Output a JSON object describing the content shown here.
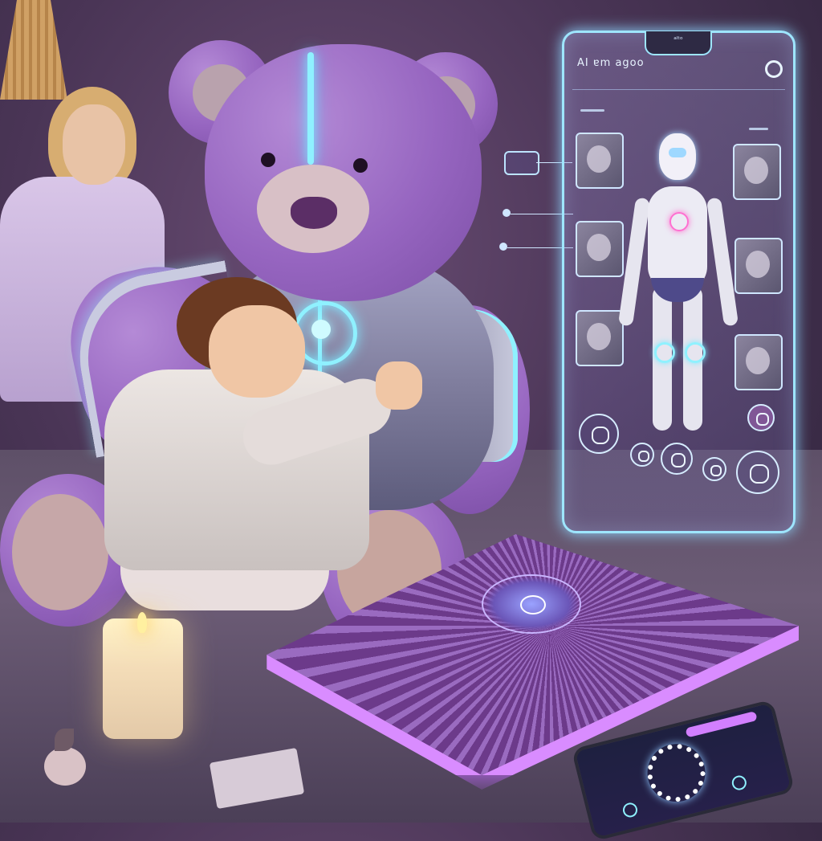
{
  "hologram": {
    "app_title": "AI ɐm agoo",
    "notch_label": "ᵃˡᵗᵒ"
  },
  "colors": {
    "glow_cyan": "#8ff1ff",
    "pillow_purple": "#c46bff",
    "bear_fur": "#9665c0"
  },
  "icons": {
    "top_right": "record-icon",
    "robot_heart": "heart-icon",
    "phone_ring": "loading-ring-icon"
  }
}
